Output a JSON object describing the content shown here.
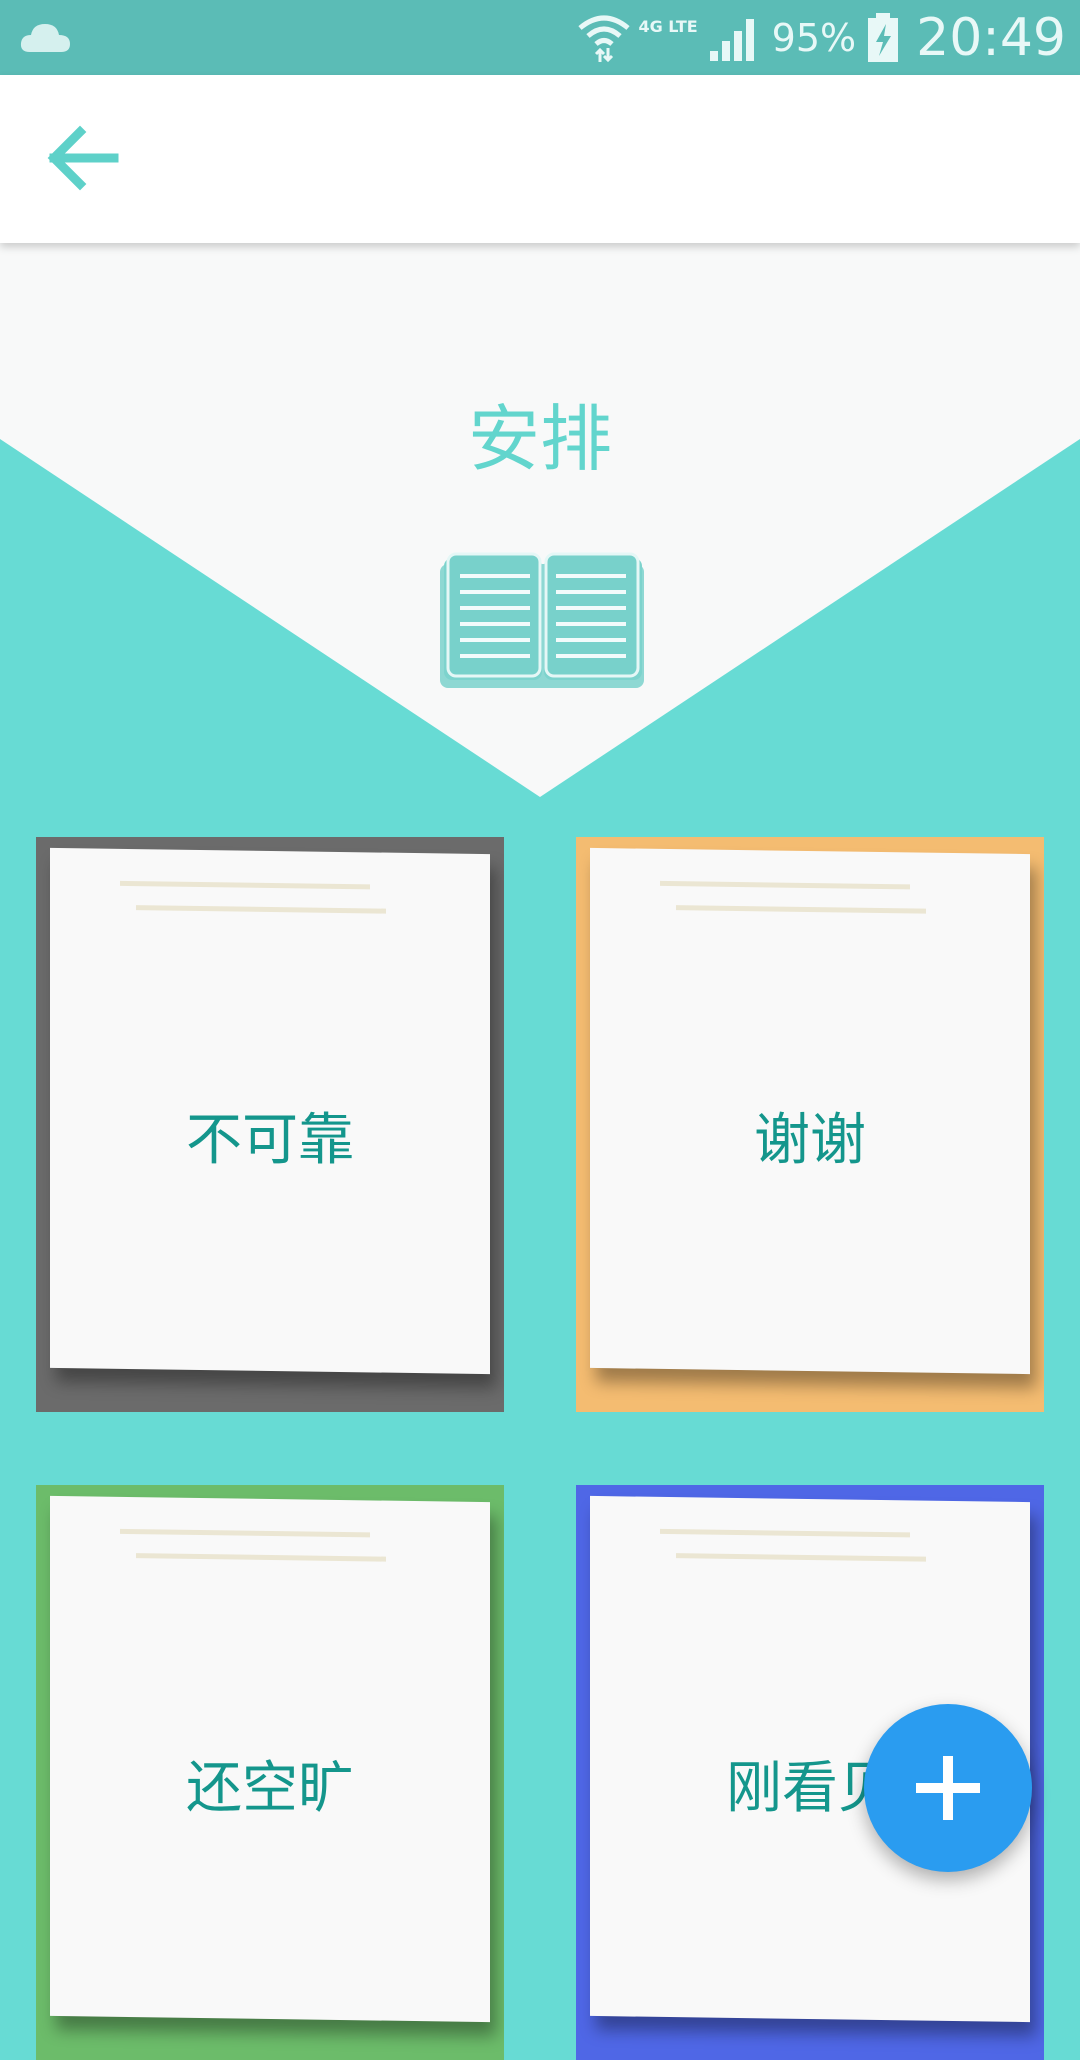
{
  "status_bar": {
    "network": "4G LTE",
    "battery_percent": "95%",
    "time": "20:49",
    "icons": [
      "cloud-icon",
      "wifi-icon",
      "signal-icon",
      "battery-charging-icon"
    ]
  },
  "app_bar": {
    "back_icon": "arrow-left-icon"
  },
  "header": {
    "title": "安排",
    "icon": "open-book-icon"
  },
  "notes": [
    {
      "label": "不可靠",
      "color": "#6b6b6b"
    },
    {
      "label": "谢谢",
      "color": "#f4bc71"
    },
    {
      "label": "还空旷",
      "color": "#6cbc6a"
    },
    {
      "label": "刚看见",
      "color": "#4f67e6"
    }
  ],
  "fab": {
    "icon": "plus-icon",
    "color": "#2a9cf0"
  },
  "colors": {
    "accent": "#67dbd4",
    "status_bar": "#5bbcb6",
    "note_text": "#14968c"
  }
}
